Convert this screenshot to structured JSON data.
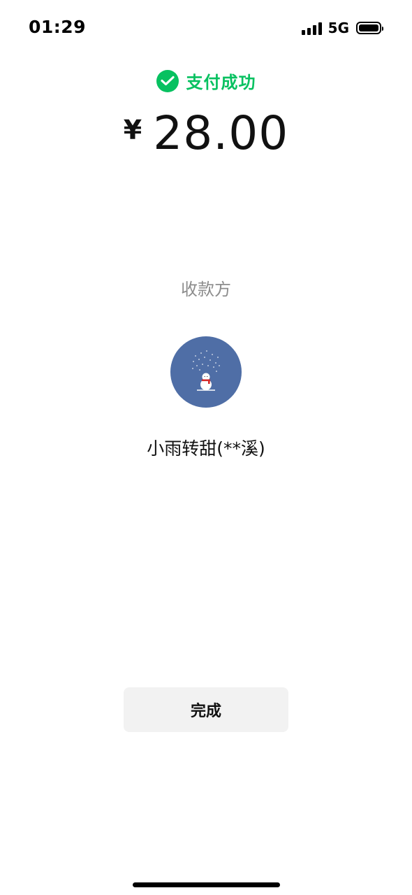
{
  "status_bar": {
    "time": "01:29",
    "network": "5G",
    "icons": [
      "signal-bars-icon",
      "battery-icon"
    ]
  },
  "payment": {
    "status_icon": "wechat-pay-icon",
    "status_text": "支付成功",
    "currency_symbol": "¥",
    "amount": "28.00",
    "accent_color": "#07c160"
  },
  "payee": {
    "label": "收款方",
    "name": "小雨转甜(**溪)",
    "avatar_icon": "snowman-avatar-icon",
    "avatar_color": "#4f6ea6"
  },
  "actions": {
    "done_label": "完成"
  }
}
